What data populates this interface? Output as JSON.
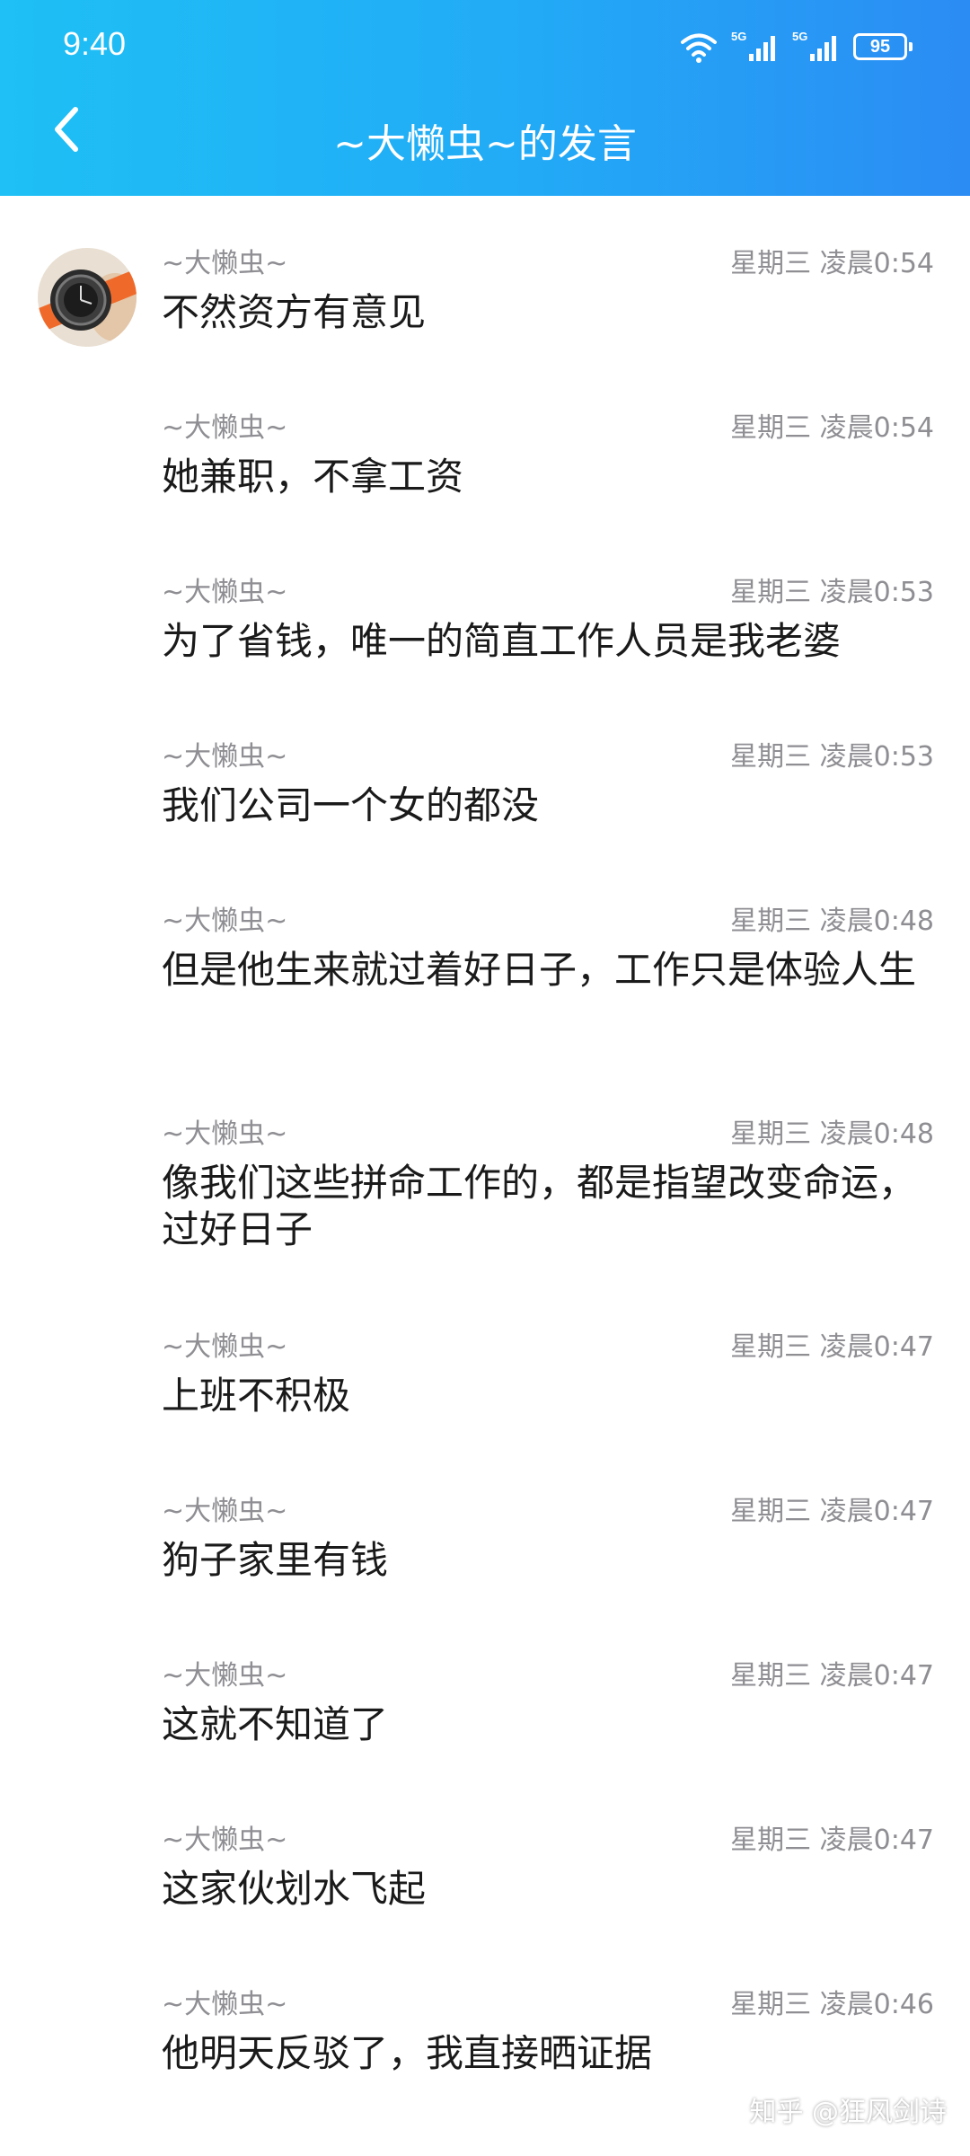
{
  "status_bar": {
    "time": "9:40",
    "battery": "95",
    "signal_label_1": "5G",
    "signal_label_2": "5G"
  },
  "header": {
    "title": "~大懒虫~的发言"
  },
  "messages": [
    {
      "name": "~大懒虫~",
      "time": "星期三 凌晨0:54",
      "text": "不然资方有意见"
    },
    {
      "name": "~大懒虫~",
      "time": "星期三 凌晨0:54",
      "text": "她兼职，不拿工资"
    },
    {
      "name": "~大懒虫~",
      "time": "星期三 凌晨0:53",
      "text": "为了省钱，唯一的简直工作人员是我老婆"
    },
    {
      "name": "~大懒虫~",
      "time": "星期三 凌晨0:53",
      "text": "我们公司一个女的都没"
    },
    {
      "name": "~大懒虫~",
      "time": "星期三 凌晨0:48",
      "text": "但是他生来就过着好日子，工作只是体验人生"
    },
    {
      "name": "~大懒虫~",
      "time": "星期三 凌晨0:48",
      "text": "像我们这些拼命工作的，都是指望改变命运，过好日子"
    },
    {
      "name": "~大懒虫~",
      "time": "星期三 凌晨0:47",
      "text": "上班不积极"
    },
    {
      "name": "~大懒虫~",
      "time": "星期三 凌晨0:47",
      "text": "狗子家里有钱"
    },
    {
      "name": "~大懒虫~",
      "time": "星期三 凌晨0:47",
      "text": "这就不知道了"
    },
    {
      "name": "~大懒虫~",
      "time": "星期三 凌晨0:47",
      "text": "这家伙划水飞起"
    },
    {
      "name": "~大懒虫~",
      "time": "星期三 凌晨0:46",
      "text": "他明天反驳了，我直接晒证据"
    }
  ],
  "watermark": "知乎 @狂风剑诗",
  "colors": {
    "header_start": "#1ec0f5",
    "header_end": "#2b8cf4",
    "meta_text": "#8e8e93",
    "message_text": "#1a1a1a"
  }
}
